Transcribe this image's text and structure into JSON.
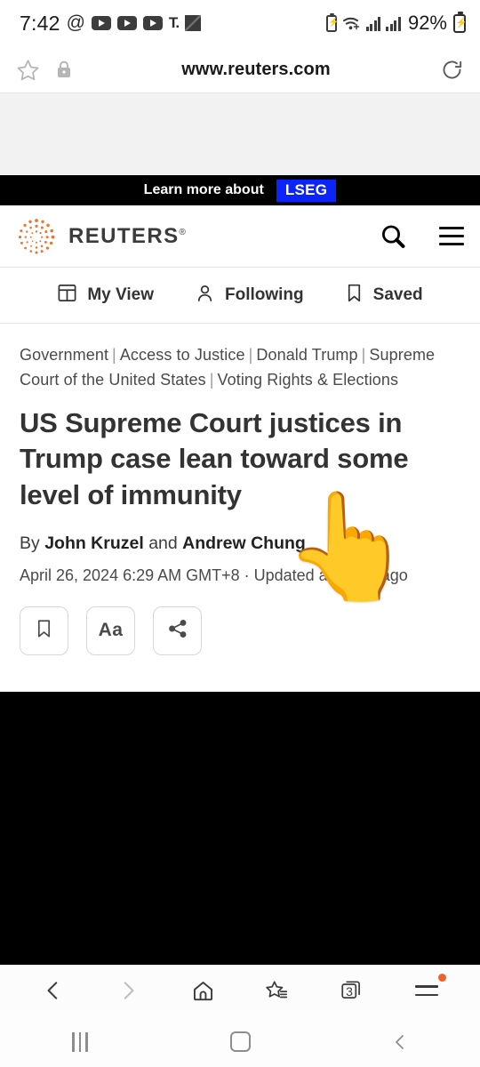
{
  "status_bar": {
    "time": "7:42",
    "at_symbol": "@",
    "tiktok_glyph": "T.",
    "battery_percent": "92%",
    "icons": [
      "at-icon",
      "youtube-icon",
      "youtube-icon",
      "youtube-icon",
      "tiktok-icon",
      "qr-icon",
      "battery-small-icon",
      "wifi-icon",
      "signal-icon",
      "signal-icon",
      "battery-icon"
    ]
  },
  "url_bar": {
    "url": "www.reuters.com",
    "star_icon": "star-icon",
    "lock_icon": "lock-icon",
    "reload_icon": "reload-icon"
  },
  "promo": {
    "text": "Learn more about",
    "badge": "LSEG",
    "badge_color": "#0b24fb"
  },
  "masthead": {
    "brand": "REUTERS",
    "registered": "®",
    "brand_color": "#fa6400",
    "search_icon": "search-icon",
    "menu_icon": "hamburger-menu-icon"
  },
  "tabs": [
    {
      "label": "My View",
      "icon": "dashboard-icon"
    },
    {
      "label": "Following",
      "icon": "person-icon"
    },
    {
      "label": "Saved",
      "icon": "bookmark-icon"
    }
  ],
  "article": {
    "kickers": [
      "Government",
      "Access to Justice",
      "Donald Trump",
      "Supreme Court of the United States",
      "Voting Rights & Elections"
    ],
    "separator": "|",
    "headline": "US Supreme Court justices in Trump case lean toward some level of immunity",
    "byline_prefix": "By ",
    "author_one": "John Kruzel",
    "byline_conjunction": " and ",
    "author_two": "Andrew Chung",
    "timestamp": "April 26, 2024 6:29 AM GMT+8 · Updated a month ago",
    "actions": [
      {
        "name": "bookmark",
        "icon": "bookmark-icon",
        "label": ""
      },
      {
        "name": "text-size",
        "icon": "text-size-icon",
        "label": "Aa"
      },
      {
        "name": "share",
        "icon": "share-icon",
        "label": ""
      }
    ]
  },
  "cursor": {
    "glyph": "👆",
    "name": "pointing-hand-cursor"
  },
  "browser_bar": {
    "back_icon": "chevron-left-icon",
    "forward_icon": "chevron-right-icon",
    "home_icon": "home-icon",
    "bookmarks_icon": "star-list-icon",
    "tabs_icon": "tabs-icon",
    "tab_count": "3",
    "menu_icon": "hamburger-menu-icon",
    "menu_badge_color": "#f1622a"
  },
  "nav_bar": {
    "recents_icon": "recents-icon",
    "home_icon": "home-square-icon",
    "back_icon": "chevron-left-icon"
  }
}
